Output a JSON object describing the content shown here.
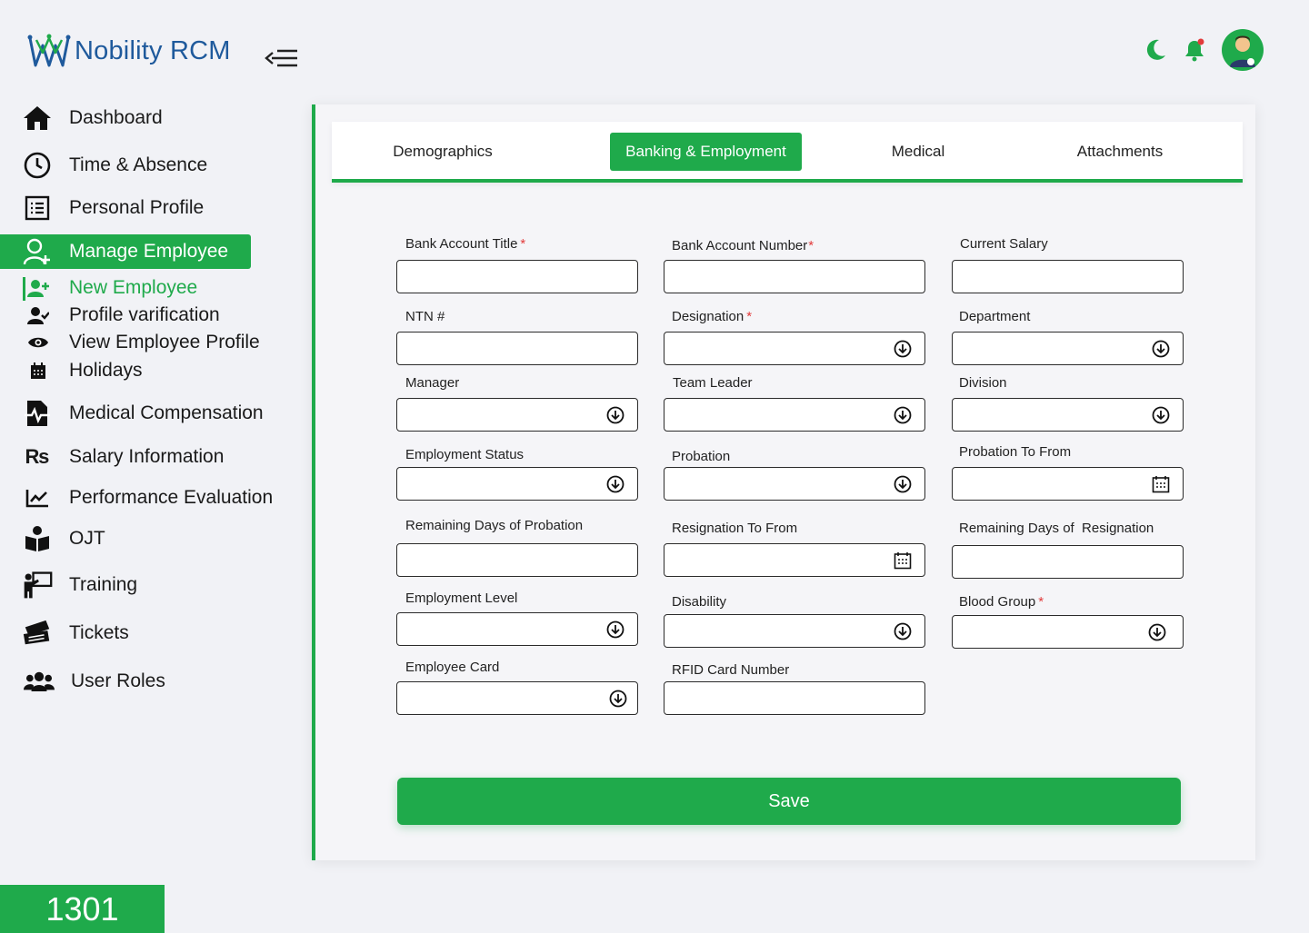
{
  "app": {
    "name": "Nobility RCM"
  },
  "header": {
    "icons": [
      "moon-icon",
      "bell-icon",
      "avatar"
    ],
    "notification_dot_color": "#e23b3b"
  },
  "sidebar": {
    "items": [
      {
        "label": "Dashboard",
        "icon": "home-icon"
      },
      {
        "label": "Time & Absence",
        "icon": "clock-icon"
      },
      {
        "label": "Personal Profile",
        "icon": "list-icon"
      },
      {
        "label": "Manage Employee",
        "icon": "manage-user-icon",
        "active": true
      },
      {
        "label": "Medical Compensation",
        "icon": "medical-file-icon"
      },
      {
        "label": "Salary Information",
        "icon": "rupee-icon"
      },
      {
        "label": "Performance Evaluation",
        "icon": "chart-icon"
      },
      {
        "label": "OJT",
        "icon": "reading-icon"
      },
      {
        "label": "Training",
        "icon": "trainer-icon"
      },
      {
        "label": "Tickets",
        "icon": "ticket-icon"
      },
      {
        "label": "User Roles",
        "icon": "users-icon"
      }
    ],
    "sub_items": [
      {
        "label": "New Employee",
        "icon": "user-plus-icon",
        "active": true
      },
      {
        "label": "Profile varification",
        "icon": "user-check-icon"
      },
      {
        "label": "View Employee Profile",
        "icon": "eye-icon"
      },
      {
        "label": "Holidays",
        "icon": "calendar-icon"
      }
    ]
  },
  "badge": {
    "value": "1301"
  },
  "tabs": [
    {
      "label": "Demographics"
    },
    {
      "label": "Banking & Employment",
      "active": true
    },
    {
      "label": "Medical"
    },
    {
      "label": "Attachments"
    }
  ],
  "form": {
    "fields": [
      {
        "label": "Bank Account Title",
        "required": true,
        "type": "text",
        "value": ""
      },
      {
        "label": "Bank Account Number",
        "required": true,
        "type": "text",
        "value": ""
      },
      {
        "label": "Current Salary",
        "required": false,
        "type": "text",
        "value": ""
      },
      {
        "label": "NTN #",
        "required": false,
        "type": "text",
        "value": ""
      },
      {
        "label": "Designation",
        "required": true,
        "type": "select",
        "value": ""
      },
      {
        "label": "Department",
        "required": false,
        "type": "select",
        "value": ""
      },
      {
        "label": "Manager",
        "required": false,
        "type": "select",
        "value": ""
      },
      {
        "label": "Team Leader",
        "required": false,
        "type": "select",
        "value": ""
      },
      {
        "label": "Division",
        "required": false,
        "type": "select",
        "value": ""
      },
      {
        "label": "Employment Status",
        "required": false,
        "type": "select",
        "value": ""
      },
      {
        "label": "Probation",
        "required": false,
        "type": "select",
        "value": ""
      },
      {
        "label": "Probation To From",
        "required": false,
        "type": "date",
        "value": ""
      },
      {
        "label": "Remaining Days of Probation",
        "required": false,
        "type": "text",
        "value": ""
      },
      {
        "label": "Resignation To From",
        "required": false,
        "type": "date",
        "value": ""
      },
      {
        "label": "Remaining Days of  Resignation",
        "required": false,
        "type": "text",
        "value": ""
      },
      {
        "label": "Employment Level",
        "required": false,
        "type": "select",
        "value": ""
      },
      {
        "label": "Disability",
        "required": false,
        "type": "select",
        "value": ""
      },
      {
        "label": "Blood Group",
        "required": true,
        "type": "select",
        "value": ""
      },
      {
        "label": "Employee Card",
        "required": false,
        "type": "select",
        "value": ""
      },
      {
        "label": "RFID Card Number",
        "required": false,
        "type": "text",
        "value": ""
      }
    ],
    "save_label": "Save",
    "required_marker": "*"
  },
  "colors": {
    "accent": "#1faa4b",
    "brand_text": "#1f5a9c",
    "required": "#e23b3b"
  }
}
